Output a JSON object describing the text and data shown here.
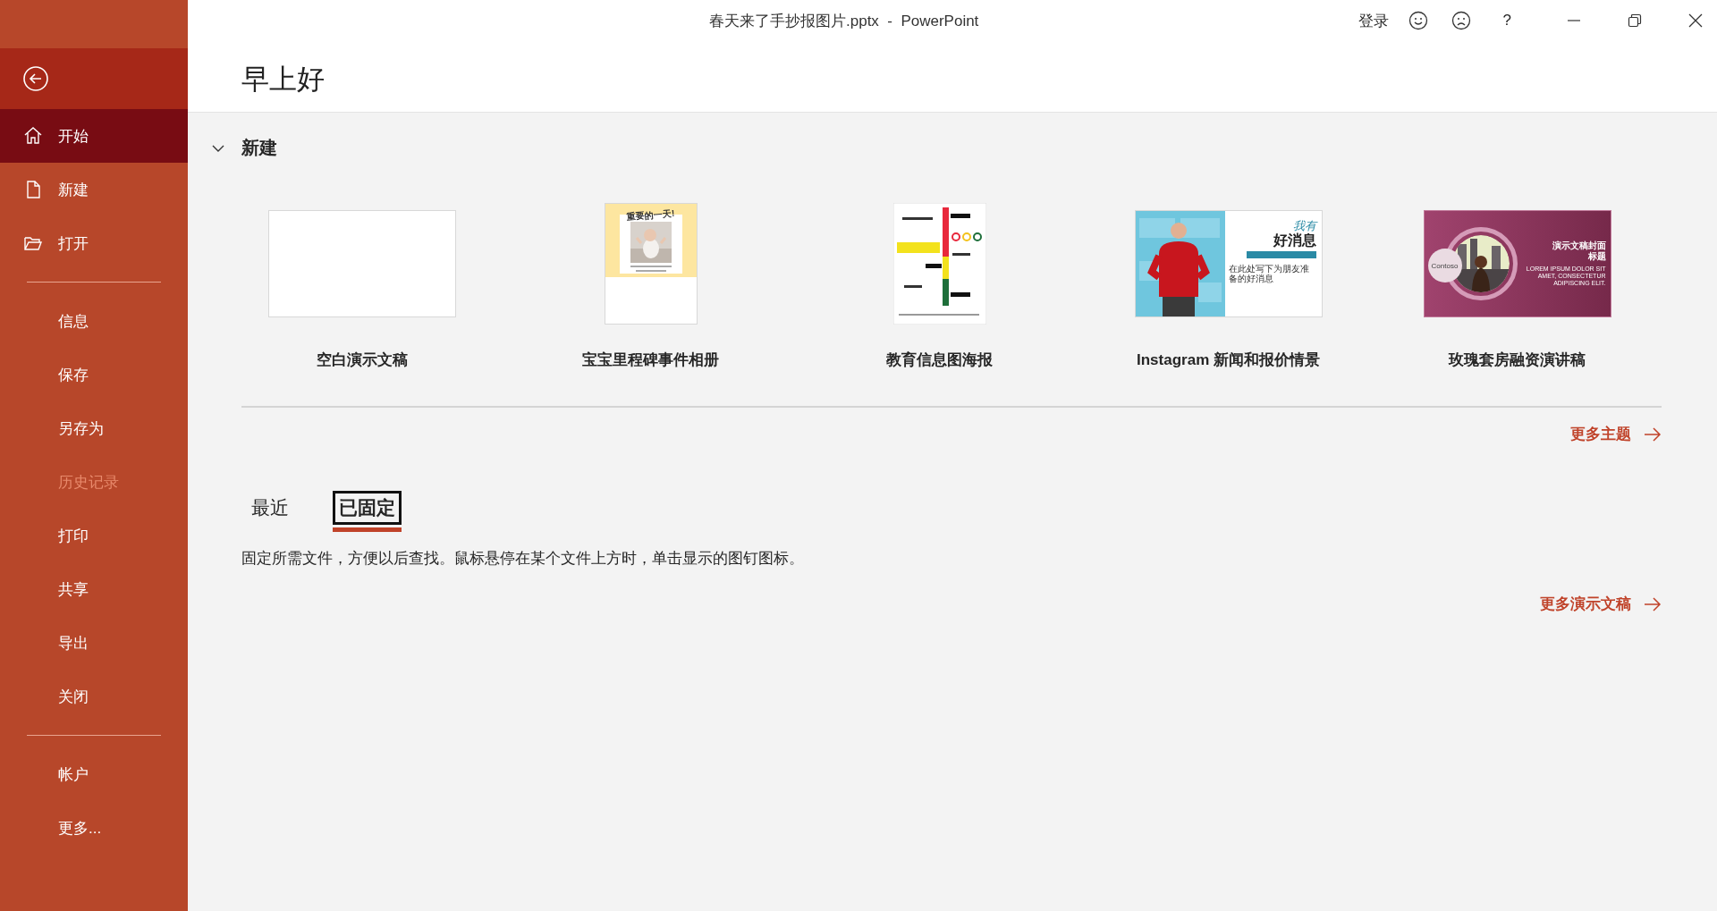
{
  "window": {
    "title": "春天来了手抄报图片.pptx  -  PowerPoint",
    "sign_in": "登录",
    "help": "?"
  },
  "sidebar": {
    "sections": [
      {
        "items": [
          {
            "label": "开始",
            "kind": "home",
            "selected": true,
            "disabled": false
          },
          {
            "label": "新建",
            "kind": "document",
            "selected": false,
            "disabled": false
          },
          {
            "label": "打开",
            "kind": "folder",
            "selected": false,
            "disabled": false
          }
        ]
      },
      {
        "items": [
          {
            "label": "信息",
            "kind": "plain",
            "selected": false,
            "disabled": false
          },
          {
            "label": "保存",
            "kind": "plain",
            "selected": false,
            "disabled": false
          },
          {
            "label": "另存为",
            "kind": "plain",
            "selected": false,
            "disabled": false
          },
          {
            "label": "历史记录",
            "kind": "plain",
            "selected": false,
            "disabled": true
          },
          {
            "label": "打印",
            "kind": "plain",
            "selected": false,
            "disabled": false
          },
          {
            "label": "共享",
            "kind": "plain",
            "selected": false,
            "disabled": false
          },
          {
            "label": "导出",
            "kind": "plain",
            "selected": false,
            "disabled": false
          },
          {
            "label": "关闭",
            "kind": "plain",
            "selected": false,
            "disabled": false
          }
        ]
      },
      {
        "items": [
          {
            "label": "帐户",
            "kind": "plain",
            "selected": false,
            "disabled": false
          },
          {
            "label": "更多...",
            "kind": "plain",
            "selected": false,
            "disabled": false
          }
        ]
      }
    ]
  },
  "greeting": "早上好",
  "new_section": {
    "title": "新建",
    "expanded": true,
    "templates": [
      {
        "label": "空白演示文稿",
        "kind": "blank"
      },
      {
        "label": "宝宝里程碑事件相册",
        "kind": "album",
        "texts": [
          "重要的一天!"
        ]
      },
      {
        "label": "教育信息图海报",
        "kind": "poster"
      },
      {
        "label": "Instagram 新闻和报价情景",
        "kind": "news",
        "texts": [
          "我有",
          "好消息",
          "在此处写下为朋友准备的好消息"
        ]
      },
      {
        "label": "玫瑰套房融资演讲稿",
        "kind": "pitch",
        "texts": [
          "Contoso",
          "演示文稿封面标题",
          "LOREM IPSUM DOLOR SIT AMET, CONSECTETUR ADIPISCING ELIT."
        ]
      }
    ],
    "more_link": "更多主题"
  },
  "tabs": [
    {
      "label": "最近",
      "selected": false
    },
    {
      "label": "已固定",
      "selected": true
    }
  ],
  "pinned_hint": "固定所需文件，方便以后查找。鼠标悬停在某个文件上方时，单击显示的图钉图标。",
  "more_link": "更多演示文稿"
}
